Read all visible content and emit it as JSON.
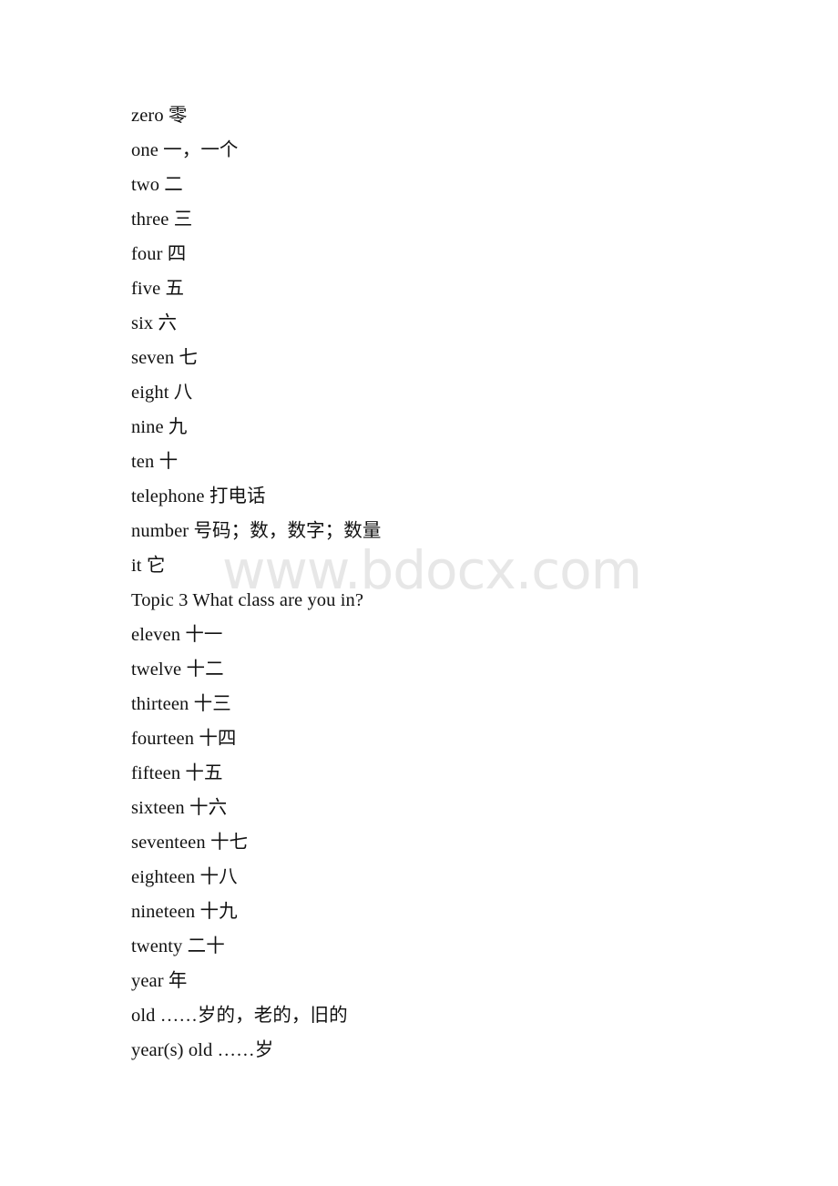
{
  "document": {
    "page_background": "#ffffff",
    "text_color": "#121212",
    "watermark": {
      "text": "www.bdocx.com",
      "color": "#e7e7e7"
    },
    "lines": [
      {
        "id": "zero",
        "text": "zero 零"
      },
      {
        "id": "one",
        "text": "one 一，一个"
      },
      {
        "id": "two",
        "text": "two 二"
      },
      {
        "id": "three",
        "text": "three 三"
      },
      {
        "id": "four",
        "text": "four 四"
      },
      {
        "id": "five",
        "text": "five 五"
      },
      {
        "id": "six",
        "text": "six 六"
      },
      {
        "id": "seven",
        "text": "seven 七"
      },
      {
        "id": "eight",
        "text": "eight 八"
      },
      {
        "id": "nine",
        "text": "nine 九"
      },
      {
        "id": "ten",
        "text": "ten 十"
      },
      {
        "id": "telephone",
        "text": "telephone 打电话"
      },
      {
        "id": "number",
        "text": "number 号码；数，数字；数量"
      },
      {
        "id": "it",
        "text": "it 它"
      },
      {
        "id": "topic-3",
        "text": "Topic 3 What class are you in?"
      },
      {
        "id": "eleven",
        "text": "eleven 十一"
      },
      {
        "id": "twelve",
        "text": "twelve 十二"
      },
      {
        "id": "thirteen",
        "text": "thirteen 十三"
      },
      {
        "id": "fourteen",
        "text": "fourteen 十四"
      },
      {
        "id": "fifteen",
        "text": "fifteen 十五"
      },
      {
        "id": "sixteen",
        "text": "sixteen 十六"
      },
      {
        "id": "seventeen",
        "text": "seventeen 十七"
      },
      {
        "id": "eighteen",
        "text": "eighteen 十八"
      },
      {
        "id": "nineteen",
        "text": "nineteen 十九"
      },
      {
        "id": "twenty",
        "text": "twenty 二十"
      },
      {
        "id": "year",
        "text": "year 年"
      },
      {
        "id": "old",
        "text": "old ……岁的，老的，旧的"
      },
      {
        "id": "years-old",
        "text": "year(s) old ……岁"
      }
    ]
  }
}
